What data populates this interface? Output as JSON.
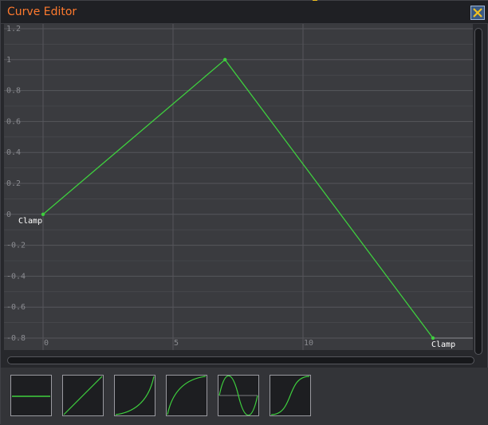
{
  "window": {
    "title": "Curve Editor",
    "close_icon": "close-x-icon"
  },
  "colors": {
    "title": "#ff7a2e",
    "curve": "#3ecf3e",
    "plot_bg": "#3a3b3f",
    "grid": "#55565b",
    "axis_text": "#8a8b90",
    "label_text": "#ffffff"
  },
  "chart_data": {
    "type": "line",
    "title": "",
    "xlabel": "",
    "ylabel": "",
    "xlim": [
      -1.5,
      16.5
    ],
    "ylim": [
      -0.8,
      1.2
    ],
    "x_ticks": [
      "0",
      "5",
      "10"
    ],
    "y_ticks": [
      "1.2",
      "1",
      "0.8",
      "0.6",
      "0.4",
      "0.2",
      "0",
      "-0.2",
      "-0.4",
      "-0.6",
      "-0.8"
    ],
    "grid": true,
    "series": [
      {
        "x": [
          0,
          7,
          15
        ],
        "y": [
          0,
          1,
          -0.8
        ]
      }
    ],
    "annotations": [
      {
        "text": "Clamp",
        "x": 0,
        "y": 0
      },
      {
        "text": "Clamp",
        "x": 15,
        "y": -0.8
      }
    ]
  },
  "presets": [
    {
      "name": "preset-constant",
      "shape": "constant"
    },
    {
      "name": "preset-linear",
      "shape": "linear"
    },
    {
      "name": "preset-ease-in",
      "shape": "ease-in"
    },
    {
      "name": "preset-ease-out",
      "shape": "ease-out"
    },
    {
      "name": "preset-sine",
      "shape": "sine"
    },
    {
      "name": "preset-ease-in-out",
      "shape": "ease-in-out"
    }
  ]
}
